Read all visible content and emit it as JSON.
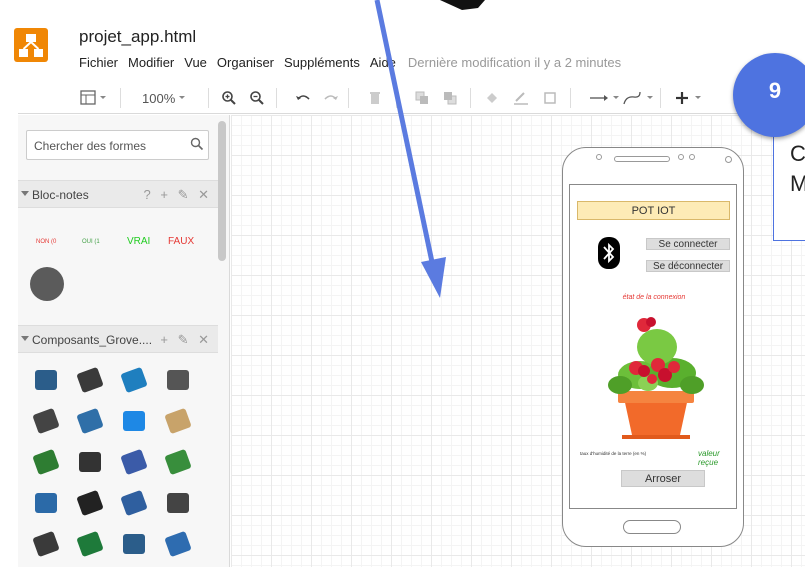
{
  "app": {
    "filename": "projet_app.html",
    "menu": [
      "Fichier",
      "Modifier",
      "Vue",
      "Organiser",
      "Suppléments",
      "Aide"
    ],
    "last_modified": "Dernière modification il y a 2 minutes"
  },
  "toolbar": {
    "zoom": "100%"
  },
  "sidebar": {
    "search_placeholder": "Chercher des formes",
    "sections": [
      {
        "title": "Bloc-notes",
        "actions": "? + ✎ ✕"
      },
      {
        "title": "Composants_Grove....",
        "actions": "+ ✎ ✕"
      }
    ],
    "notes": [
      {
        "text": "NON (0",
        "color": "#e53935"
      },
      {
        "text": "OUI (1",
        "color": "#43a047"
      },
      {
        "text": "VRAI",
        "color": "#22cc22"
      },
      {
        "text": "FAUX",
        "color": "#e53935"
      }
    ]
  },
  "phone": {
    "title": "POT IOT",
    "connect": "Se connecter",
    "disconnect": "Se déconnecter",
    "status": "état de la connexion",
    "humidity_label": "taux d'humidité de la terre (en %)",
    "value": "valeur reçue",
    "water": "Arroser"
  },
  "annotation": {
    "step": "9",
    "callout_line1": "C",
    "callout_line2": "M",
    "color": "#4e73e0"
  },
  "colors": {
    "accent": "#f08705",
    "badge": "#4e73e0"
  }
}
